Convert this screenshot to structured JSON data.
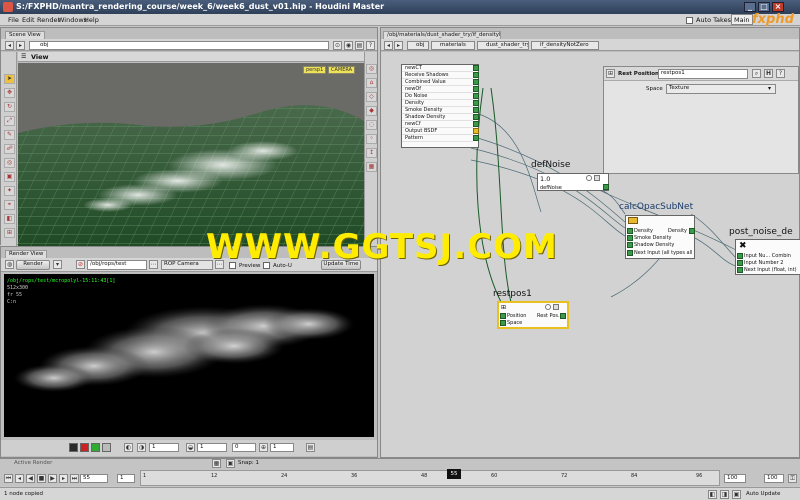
{
  "window": {
    "title": "S:/FXPHD/mantra_rendering_course/week_6/week6_dust_v01.hip - Houdini Master",
    "auto_takes_label": "Auto Takes",
    "main_label": "Main",
    "logo_text": "fxphd"
  },
  "menu": [
    "File",
    "Edit",
    "Render",
    "Windows",
    "Help"
  ],
  "scene_view": {
    "tab": "Scene View",
    "path": "obj",
    "header": "View",
    "persp_label": "persp1",
    "camera_label": "CAMERA"
  },
  "render_view": {
    "tab": "Render View",
    "render_button": "Render",
    "rop_path": "/obj/rops/test",
    "camera_menu": "ROP Camera",
    "preview_label": "Preview",
    "auto_update_label": "Auto-U",
    "update_time_button": "Update Time",
    "info_lines": [
      "/obj/rops/test/mcropolyl-15:11:43[1]",
      "512x300",
      "fr 55",
      "C:n"
    ],
    "bottom_fields": [
      "1",
      "1",
      "0",
      "1"
    ]
  },
  "network": {
    "path_tab": "/obj/materials/dust_shader_try/if_densityNotZero",
    "breadcrumbs": [
      "obj",
      "materials",
      "dust_shader_try",
      "if_densityNotZero"
    ],
    "input_list": [
      "newCT",
      "Receive Shadows",
      "Combined Value",
      "newOf",
      "Do Noise",
      "Density",
      "Smoke Density",
      "Shadow Density",
      "newCf",
      "Output BSDF",
      "Pattern"
    ],
    "parm_pane": {
      "node_type": "Rest Position",
      "node_name": "restpos1",
      "space_label": "Space",
      "space_value": "Texture"
    },
    "nodes": {
      "defnoise": {
        "name": "defNoise",
        "value": "1.0",
        "output": "defNoise"
      },
      "calcopac": {
        "name": "calcOpacSubNet",
        "rows": [
          {
            "in": "Density",
            "out": "Density"
          },
          {
            "in": "Smoke Density",
            "out": ""
          },
          {
            "in": "Shadow Density",
            "out": ""
          },
          {
            "in": "Next Input (all types all",
            "out": ""
          }
        ]
      },
      "postnoise": {
        "name": "post_noise_de",
        "rows": [
          "Input Nu... Combin",
          "Input Number 2",
          "Next Input (float, int)"
        ]
      },
      "restpos": {
        "name": "restpos1",
        "rows": [
          {
            "in": "Position",
            "out": "Rest Pos..."
          },
          {
            "in": "Space",
            "out": ""
          }
        ]
      }
    }
  },
  "watermark": "WWW.GGTSJ.COM",
  "timeline": {
    "active_render_label": "Active Render",
    "snap_label": "Snap: 1",
    "ticks": [
      "1",
      "12",
      "24",
      "36",
      "48",
      "60",
      "72",
      "84",
      "96"
    ],
    "current_frame_marker": "55",
    "current_frame_field": "55",
    "start_field": "1",
    "end_field": "100",
    "end_small": "100"
  },
  "status": {
    "message": "1 node copied",
    "auto_update_label": "Auto Update"
  },
  "colors": {
    "title_blue": "#34486a",
    "port_green": "#3a9a4a",
    "watermark_yellow": "#ffec00",
    "viewport_bg": "#6a6a66",
    "render_bg": "#000000"
  }
}
